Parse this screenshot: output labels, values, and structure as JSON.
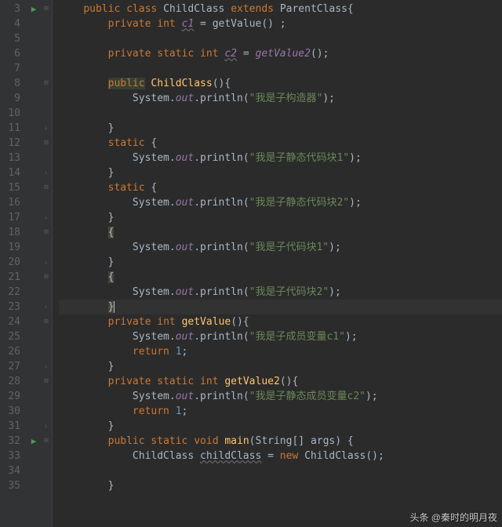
{
  "editor": {
    "startLine": 3,
    "endLine": 35,
    "runMarkers": {
      "3": true,
      "32": true
    },
    "foldMarkers": {
      "3": "down",
      "8": "minus",
      "11": "up",
      "12": "minus",
      "14": "up",
      "15": "minus",
      "17": "up",
      "18": "minus",
      "20": "up",
      "21": "minus",
      "23": "up",
      "24": "minus",
      "27": "up",
      "28": "minus",
      "31": "up",
      "32": "minus"
    },
    "currentLine": 23
  },
  "code": {
    "l3": {
      "kw1": "public",
      "kw2": "class",
      "cls": "ChildClass",
      "kw3": "extends",
      "parent": "ParentClass",
      "brace": "{"
    },
    "l4": {
      "kw1": "private",
      "kw2": "int",
      "field": "c1",
      "eq": " = ",
      "call": "getValue",
      "paren": "() ;"
    },
    "l6": {
      "kw1": "private",
      "kw2": "static",
      "kw3": "int",
      "field": "c2",
      "eq": " = ",
      "call": "getValue2",
      "paren": "();"
    },
    "l8": {
      "kw1": "public",
      "ctor": "ChildClass",
      "paren": "(){"
    },
    "l9": {
      "sys": "System.",
      "out": "out",
      "dot": ".",
      "meth": "println",
      "lp": "(",
      "str": "\"我是子构造器\"",
      "rp": ");"
    },
    "l11": {
      "brace": "}"
    },
    "l12": {
      "kw": "static",
      "brace": " {"
    },
    "l13": {
      "sys": "System.",
      "out": "out",
      "dot": ".",
      "meth": "println",
      "lp": "(",
      "str": "\"我是子静态代码块1\"",
      "rp": ");"
    },
    "l14": {
      "brace": "}"
    },
    "l15": {
      "kw": "static",
      "brace": " {"
    },
    "l16": {
      "sys": "System.",
      "out": "out",
      "dot": ".",
      "meth": "println",
      "lp": "(",
      "str": "\"我是子静态代码块2\"",
      "rp": ");"
    },
    "l17": {
      "brace": "}"
    },
    "l18": {
      "brace": "{"
    },
    "l19": {
      "sys": "System.",
      "out": "out",
      "dot": ".",
      "meth": "println",
      "lp": "(",
      "str": "\"我是子代码块1\"",
      "rp": ");"
    },
    "l20": {
      "brace": "}"
    },
    "l21": {
      "brace": "{"
    },
    "l22": {
      "sys": "System.",
      "out": "out",
      "dot": ".",
      "meth": "println",
      "lp": "(",
      "str": "\"我是子代码块2\"",
      "rp": ");"
    },
    "l23": {
      "brace": "}"
    },
    "l24": {
      "kw1": "private",
      "kw2": "int",
      "meth": "getValue",
      "paren": "(){"
    },
    "l25": {
      "sys": "System.",
      "out": "out",
      "dot": ".",
      "meth": "println",
      "lp": "(",
      "str": "\"我是子成员变量c1\"",
      "rp": ");"
    },
    "l26": {
      "kw": "return",
      "num": "1",
      "semi": ";"
    },
    "l27": {
      "brace": "}"
    },
    "l28": {
      "kw1": "private",
      "kw2": "static",
      "kw3": "int",
      "meth": "getValue2",
      "paren": "(){"
    },
    "l29": {
      "sys": "System.",
      "out": "out",
      "dot": ".",
      "meth": "println",
      "lp": "(",
      "str": "\"我是子静态成员变量c2\"",
      "rp": ");"
    },
    "l30": {
      "kw": "return",
      "num": "1",
      "semi": ";"
    },
    "l31": {
      "brace": "}"
    },
    "l32": {
      "kw1": "public",
      "kw2": "static",
      "kw3": "void",
      "meth": "main",
      "lp": "(",
      "type": "String",
      "arr": "[] ",
      "arg": "args",
      "rp": ") {"
    },
    "l33": {
      "cls": "ChildClass ",
      "var": "childClass",
      "eq": " = ",
      "kw": "new",
      "ctor": " ChildClass();"
    },
    "l35": {
      "brace": "}"
    }
  },
  "watermark": "头条 @秦时的明月夜"
}
